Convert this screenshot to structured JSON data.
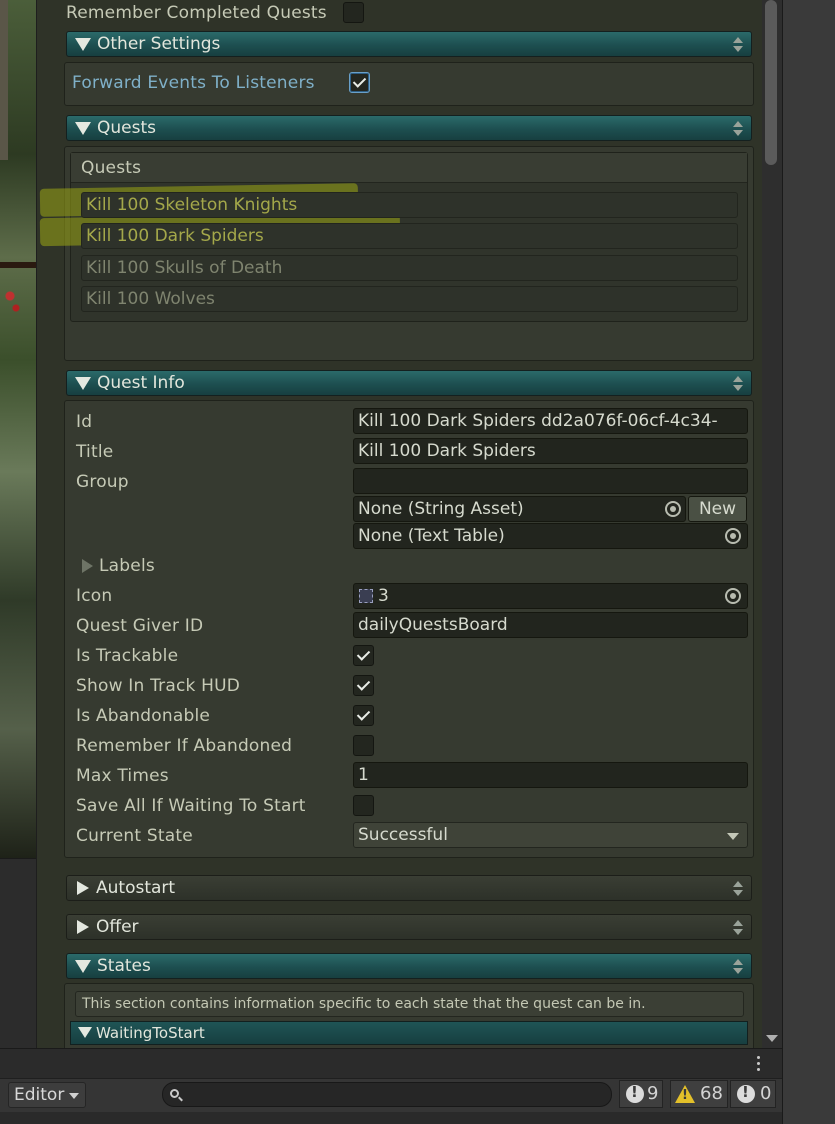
{
  "top": {
    "remember_completed_label": "Remember Completed Quests",
    "remember_completed": false
  },
  "other_settings": {
    "header": "Other Settings",
    "forward_events_label": "Forward Events To Listeners",
    "forward_events": true
  },
  "quests": {
    "header": "Quests",
    "list_title": "Quests",
    "items": [
      "Kill 100 Skeleton Knights",
      "Kill 100 Dark Spiders",
      "Kill 100 Skulls of Death",
      "Kill 100 Wolves"
    ]
  },
  "quest_info": {
    "header": "Quest Info",
    "id_label": "Id",
    "id_value": "Kill 100 Dark Spiders dd2a076f-06cf-4c34-",
    "title_label": "Title",
    "title_value": "Kill 100 Dark Spiders",
    "group_label": "Group",
    "group_value": "",
    "string_asset_value": "None (String Asset)",
    "new_button": "New",
    "text_table_value": "None (Text Table)",
    "labels_label": "Labels",
    "icon_label": "Icon",
    "icon_value": "3",
    "giver_label": "Quest Giver ID",
    "giver_value": "dailyQuestsBoard",
    "trackable_label": "Is Trackable",
    "show_hud_label": "Show In Track HUD",
    "abandonable_label": "Is Abandonable",
    "remember_abandoned_label": "Remember If Abandoned",
    "max_times_label": "Max Times",
    "max_times_value": "1",
    "save_all_label": "Save All If Waiting To Start",
    "state_label": "Current State",
    "state_value": "Successful"
  },
  "autostart": {
    "header": "Autostart"
  },
  "offer": {
    "header": "Offer"
  },
  "states": {
    "header": "States",
    "help": "This section contains information specific to each state that the quest can be in.",
    "first_state": "WaitingToStart"
  },
  "console": {
    "editor_label": "Editor",
    "search_placeholder": "",
    "info_count": "9",
    "warning_count": "68",
    "error_count": "0"
  }
}
